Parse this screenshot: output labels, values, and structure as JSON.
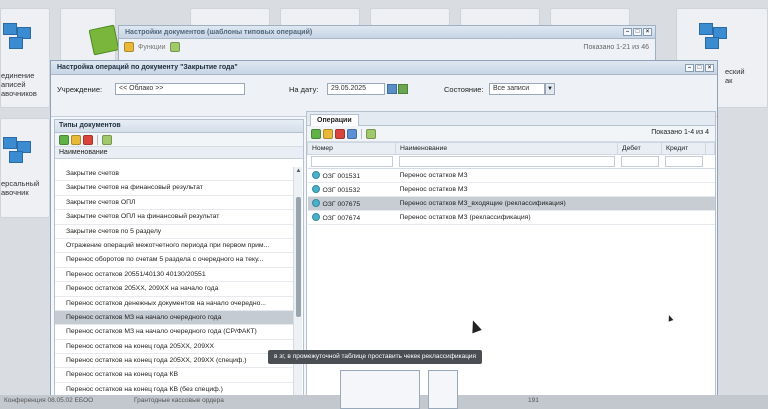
{
  "desktop": {
    "left_tiles": [
      {
        "caption": "единение\nаписей\nавочников"
      },
      {
        "caption": "ерсальный\nавочник"
      }
    ],
    "right_tile": {
      "caption": "еский\nак"
    }
  },
  "back_window": {
    "title": "Настройки документов (шаблоны типовых операций)",
    "toolbar_label": "Функции",
    "shown": "Показано 1-21 из 46",
    "minimize": "–",
    "maximize": "□",
    "close": "×"
  },
  "main_window": {
    "title": "Настройка операций по документу \"Закрытие года\"",
    "minimize": "–",
    "maximize": "□",
    "close": "×",
    "filters": {
      "institution_label": "Учреждение:",
      "institution_value": "<< Облако >>",
      "date_label": "На дату:",
      "date_value": "29.05.2025",
      "state_label": "Состояние:",
      "state_value": "Все записи",
      "dropdown_arrow": "▼"
    },
    "left_panel": {
      "title": "Типы документов",
      "column_header": "Наименование",
      "items": [
        "Закрытие счетов",
        "Закрытие счетов на финансовый результат",
        "Закрытие счетов ОПЛ",
        "Закрытие счетов ОПЛ на финансовый результат",
        "Закрытие счетов по 5 разделу",
        "Отражение операций межотчетного периода при первом прим...",
        "Перенос оборотов по счетам 5 раздела с очередного на теку...",
        "Перенос остатков 20551/40130 40130/20551",
        "Перенос остатков 205XX, 209XX на начало года",
        "Перенос остатков денежных документов на начало очередно...",
        "Перенос остатков МЗ на начало очередного года",
        "Перенос остатков МЗ на начало очередного года (СР/ФАКТ)",
        "Перенос остатков на конец года 205XX, 209XX",
        "Перенос остатков на конец года 205XX, 209XX (специф.)",
        "Перенос остатков на конец года КВ",
        "Перенос остатков на конец года КВ (без специф.)"
      ],
      "selected_index": 10
    },
    "right_panel": {
      "tab": "Операции",
      "shown": "Показано 1-4 из 4",
      "columns": [
        "Номер",
        "Наименование",
        "Дебет",
        "Кредит"
      ],
      "rows": [
        {
          "number": "ОЗГ 001531",
          "name": "Перенос остатков МЗ",
          "debit": "",
          "credit": ""
        },
        {
          "number": "ОЗГ 001532",
          "name": "Перенос остатков МЗ",
          "debit": "",
          "credit": ""
        },
        {
          "number": "ОЗГ 007675",
          "name": "Перенос остатков МЗ_входящие (реклассификация)",
          "debit": "",
          "credit": ""
        },
        {
          "number": "ОЗГ 007674",
          "name": "Перенос остатков МЗ (реклассификация)",
          "debit": "",
          "credit": ""
        }
      ],
      "selected_index": 2
    }
  },
  "tooltip": "в зг, в промежуточной таблице проставить чекек реклассификация",
  "bottom_bar": {
    "left_text": "Конференция 08.05.02 ЕБОО",
    "mid_text": "Грантодные кассовые ордера",
    "count": "191"
  },
  "colors": {
    "selection": "#c5cbd3",
    "title_gradient": "#d5dfea",
    "accent_blue": "#3b8bd0"
  }
}
